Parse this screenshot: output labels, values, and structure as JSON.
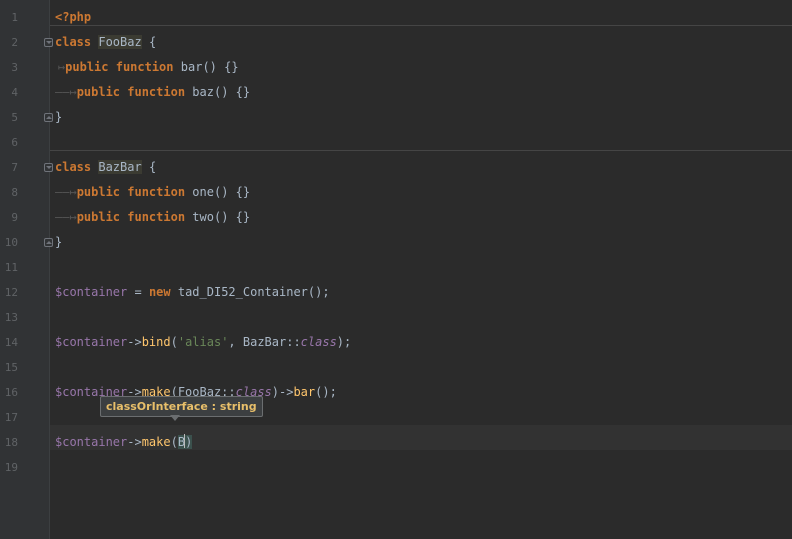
{
  "editor": {
    "line_numbers": [
      "1",
      "2",
      "3",
      "4",
      "5",
      "6",
      "7",
      "8",
      "9",
      "10",
      "11",
      "12",
      "13",
      "14",
      "15",
      "16",
      "17",
      "18",
      "19"
    ],
    "lines": {
      "l1_tag": "<?php",
      "l2_kw": "class",
      "l2_name": "FooBaz",
      "l2_brace": " {",
      "l3_kw": "public function",
      "l3_fn": "bar",
      "l3_rest": "() {}",
      "l4_kw": "public function",
      "l4_fn": "baz",
      "l4_rest": "() {}",
      "l5_brace": "}",
      "l7_kw": "class",
      "l7_name": "BazBar",
      "l7_brace": " {",
      "l8_kw": "public function",
      "l8_fn": "one",
      "l8_rest": "() {}",
      "l9_kw": "public function",
      "l9_fn": "two",
      "l9_rest": "() {}",
      "l10_brace": "}",
      "l12_var": "$container",
      "l12_op": " = ",
      "l12_new": "new",
      "l12_rest": " tad_DI52_Container();",
      "l14_var": "$container",
      "l14_arrow": "->",
      "l14_fn": "bind",
      "l14_open": "(",
      "l14_str": "'alias'",
      "l14_mid": ", BazBar::",
      "l14_class": "class",
      "l14_close": ");",
      "l16_var": "$container",
      "l16_arrow": "->",
      "l16_fn": "make",
      "l16_open": "(FooBaz::",
      "l16_class": "class",
      "l16_mid": ")->",
      "l16_fn2": "bar",
      "l16_close": "();",
      "l18_var": "$container",
      "l18_arrow": "->",
      "l18_fn": "make",
      "l18_open": "(",
      "l18_arg": "B",
      "l18_close": ")"
    },
    "tab_marker": "——↦",
    "tab_marker_short": "↦"
  },
  "tooltip": {
    "text": "classOrInterface : string"
  },
  "colors": {
    "background": "#2b2b2b",
    "keyword": "#cc7832",
    "variable": "#9876aa",
    "string": "#6a8759",
    "function": "#ffc66d",
    "text": "#a9b7c6",
    "tooltip_text": "#e8bf6a"
  }
}
